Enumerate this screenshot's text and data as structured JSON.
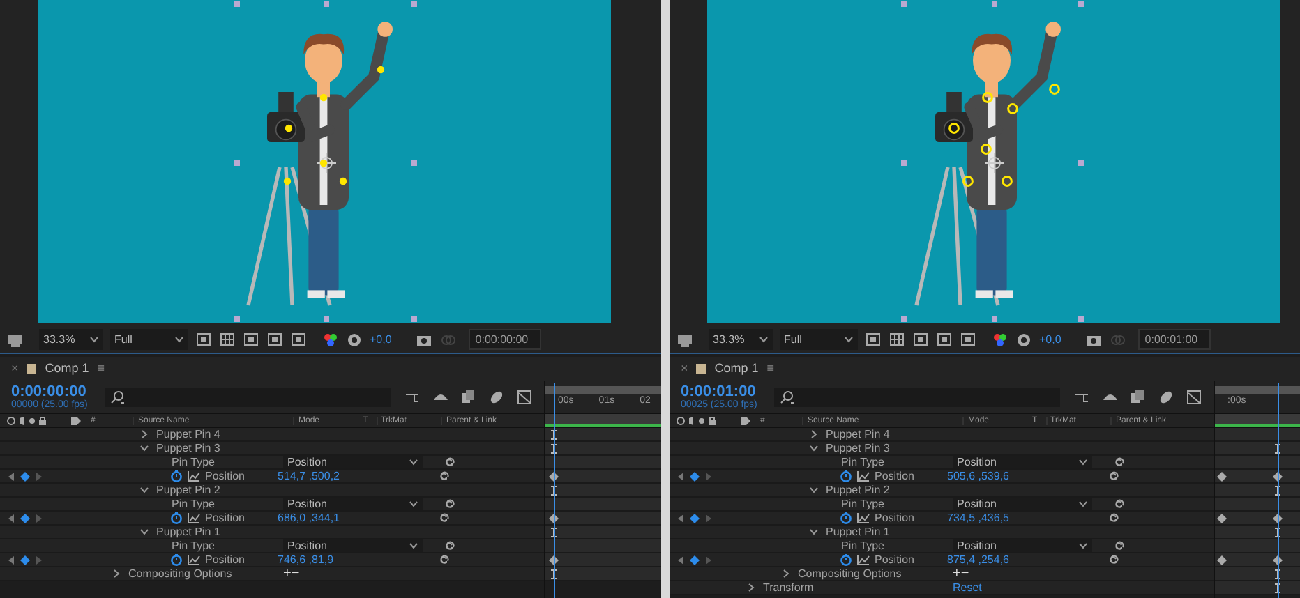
{
  "panels": [
    {
      "viewer": {
        "zoom": "33.3%",
        "resolution": "Full",
        "exposure": "+0,0",
        "timecode": "0:00:00:00",
        "pins": [
          {
            "kind": "dot"
          },
          {
            "kind": "dot"
          },
          {
            "kind": "dot"
          },
          {
            "kind": "dot"
          },
          {
            "kind": "dot"
          },
          {
            "kind": "dot"
          }
        ]
      },
      "comp_tab": {
        "close": "×",
        "title": "Comp 1",
        "menu": "≡"
      },
      "time": {
        "timecode": "0:00:00:00",
        "frames": "00000 (25.00 fps)",
        "ruler": [
          "00s",
          "01s",
          "02"
        ],
        "playhead": {
          "level": 0.07
        }
      },
      "columns": [
        "#",
        "Source Name",
        "Mode",
        "T",
        "TrkMat",
        "Parent & Link"
      ],
      "rows": [
        {
          "kind": "group",
          "label": "Puppet Pin 4",
          "expanded": false,
          "track": {
            "kind": "bar"
          }
        },
        {
          "kind": "group",
          "label": "Puppet Pin 3",
          "expanded": true,
          "track": {
            "kind": "bar"
          },
          "children": [
            {
              "kind": "pin_type",
              "label": "Pin Type",
              "value": "Position"
            },
            {
              "kind": "property",
              "label": "Position",
              "value": "514,7 ,500,2",
              "track": {
                "kind": "key"
              }
            }
          ]
        },
        {
          "kind": "group",
          "label": "Puppet Pin 2",
          "expanded": true,
          "track": {
            "kind": "bar"
          },
          "children": [
            {
              "kind": "pin_type",
              "label": "Pin Type",
              "value": "Position"
            },
            {
              "kind": "property",
              "label": "Position",
              "value": "686,0 ,344,1",
              "track": {
                "kind": "key"
              }
            }
          ]
        },
        {
          "kind": "group",
          "label": "Puppet Pin 1",
          "expanded": true,
          "track": {
            "kind": "bar"
          },
          "children": [
            {
              "kind": "pin_type",
              "label": "Pin Type",
              "value": "Position"
            },
            {
              "kind": "property",
              "label": "Position",
              "value": "746,6 ,81,9",
              "track": {
                "kind": "key"
              }
            }
          ]
        },
        {
          "kind": "section",
          "label": "Compositing Options",
          "expanded": false,
          "action": "+−",
          "track": {
            "kind": "bar"
          }
        }
      ]
    },
    {
      "viewer": {
        "zoom": "33.3%",
        "resolution": "Full",
        "exposure": "+0,0",
        "timecode": "0:00:01:00",
        "pins": [
          {
            "kind": "ring"
          },
          {
            "kind": "ring"
          },
          {
            "kind": "ring"
          },
          {
            "kind": "ring"
          },
          {
            "kind": "ring"
          },
          {
            "kind": "ring"
          },
          {
            "kind": "ring"
          }
        ]
      },
      "comp_tab": {
        "close": "×",
        "title": "Comp 1",
        "menu": "≡"
      },
      "time": {
        "timecode": "0:00:01:00",
        "frames": "00025 (25.00 fps)",
        "ruler": [
          ":00s"
        ],
        "playhead": {
          "level": 0.73
        }
      },
      "columns": [
        "#",
        "Source Name",
        "Mode",
        "T",
        "TrkMat",
        "Parent & Link"
      ],
      "rows": [
        {
          "kind": "group",
          "label": "Puppet Pin 4",
          "expanded": false
        },
        {
          "kind": "group",
          "label": "Puppet Pin 3",
          "expanded": true,
          "track": {
            "kind": "bar"
          },
          "children": [
            {
              "kind": "pin_type",
              "label": "Pin Type",
              "value": "Position"
            },
            {
              "kind": "property",
              "label": "Position",
              "value": "505,6 ,539,6",
              "track": {
                "kind": "keys"
              }
            }
          ]
        },
        {
          "kind": "group",
          "label": "Puppet Pin 2",
          "expanded": true,
          "track": {
            "kind": "bar"
          },
          "children": [
            {
              "kind": "pin_type",
              "label": "Pin Type",
              "value": "Position"
            },
            {
              "kind": "property",
              "label": "Position",
              "value": "734,5 ,436,5",
              "track": {
                "kind": "keys"
              }
            }
          ]
        },
        {
          "kind": "group",
          "label": "Puppet Pin 1",
          "expanded": true,
          "track": {
            "kind": "bar"
          },
          "children": [
            {
              "kind": "pin_type",
              "label": "Pin Type",
              "value": "Position"
            },
            {
              "kind": "property",
              "label": "Position",
              "value": "875,4 ,254,6",
              "track": {
                "kind": "keys"
              }
            }
          ]
        },
        {
          "kind": "section",
          "label": "Compositing Options",
          "expanded": false,
          "action": "+−",
          "track": {
            "kind": "bar"
          }
        },
        {
          "kind": "top_section",
          "label": "Transform",
          "expanded": false,
          "action": "Reset",
          "track": {
            "kind": "bar"
          }
        }
      ]
    }
  ]
}
